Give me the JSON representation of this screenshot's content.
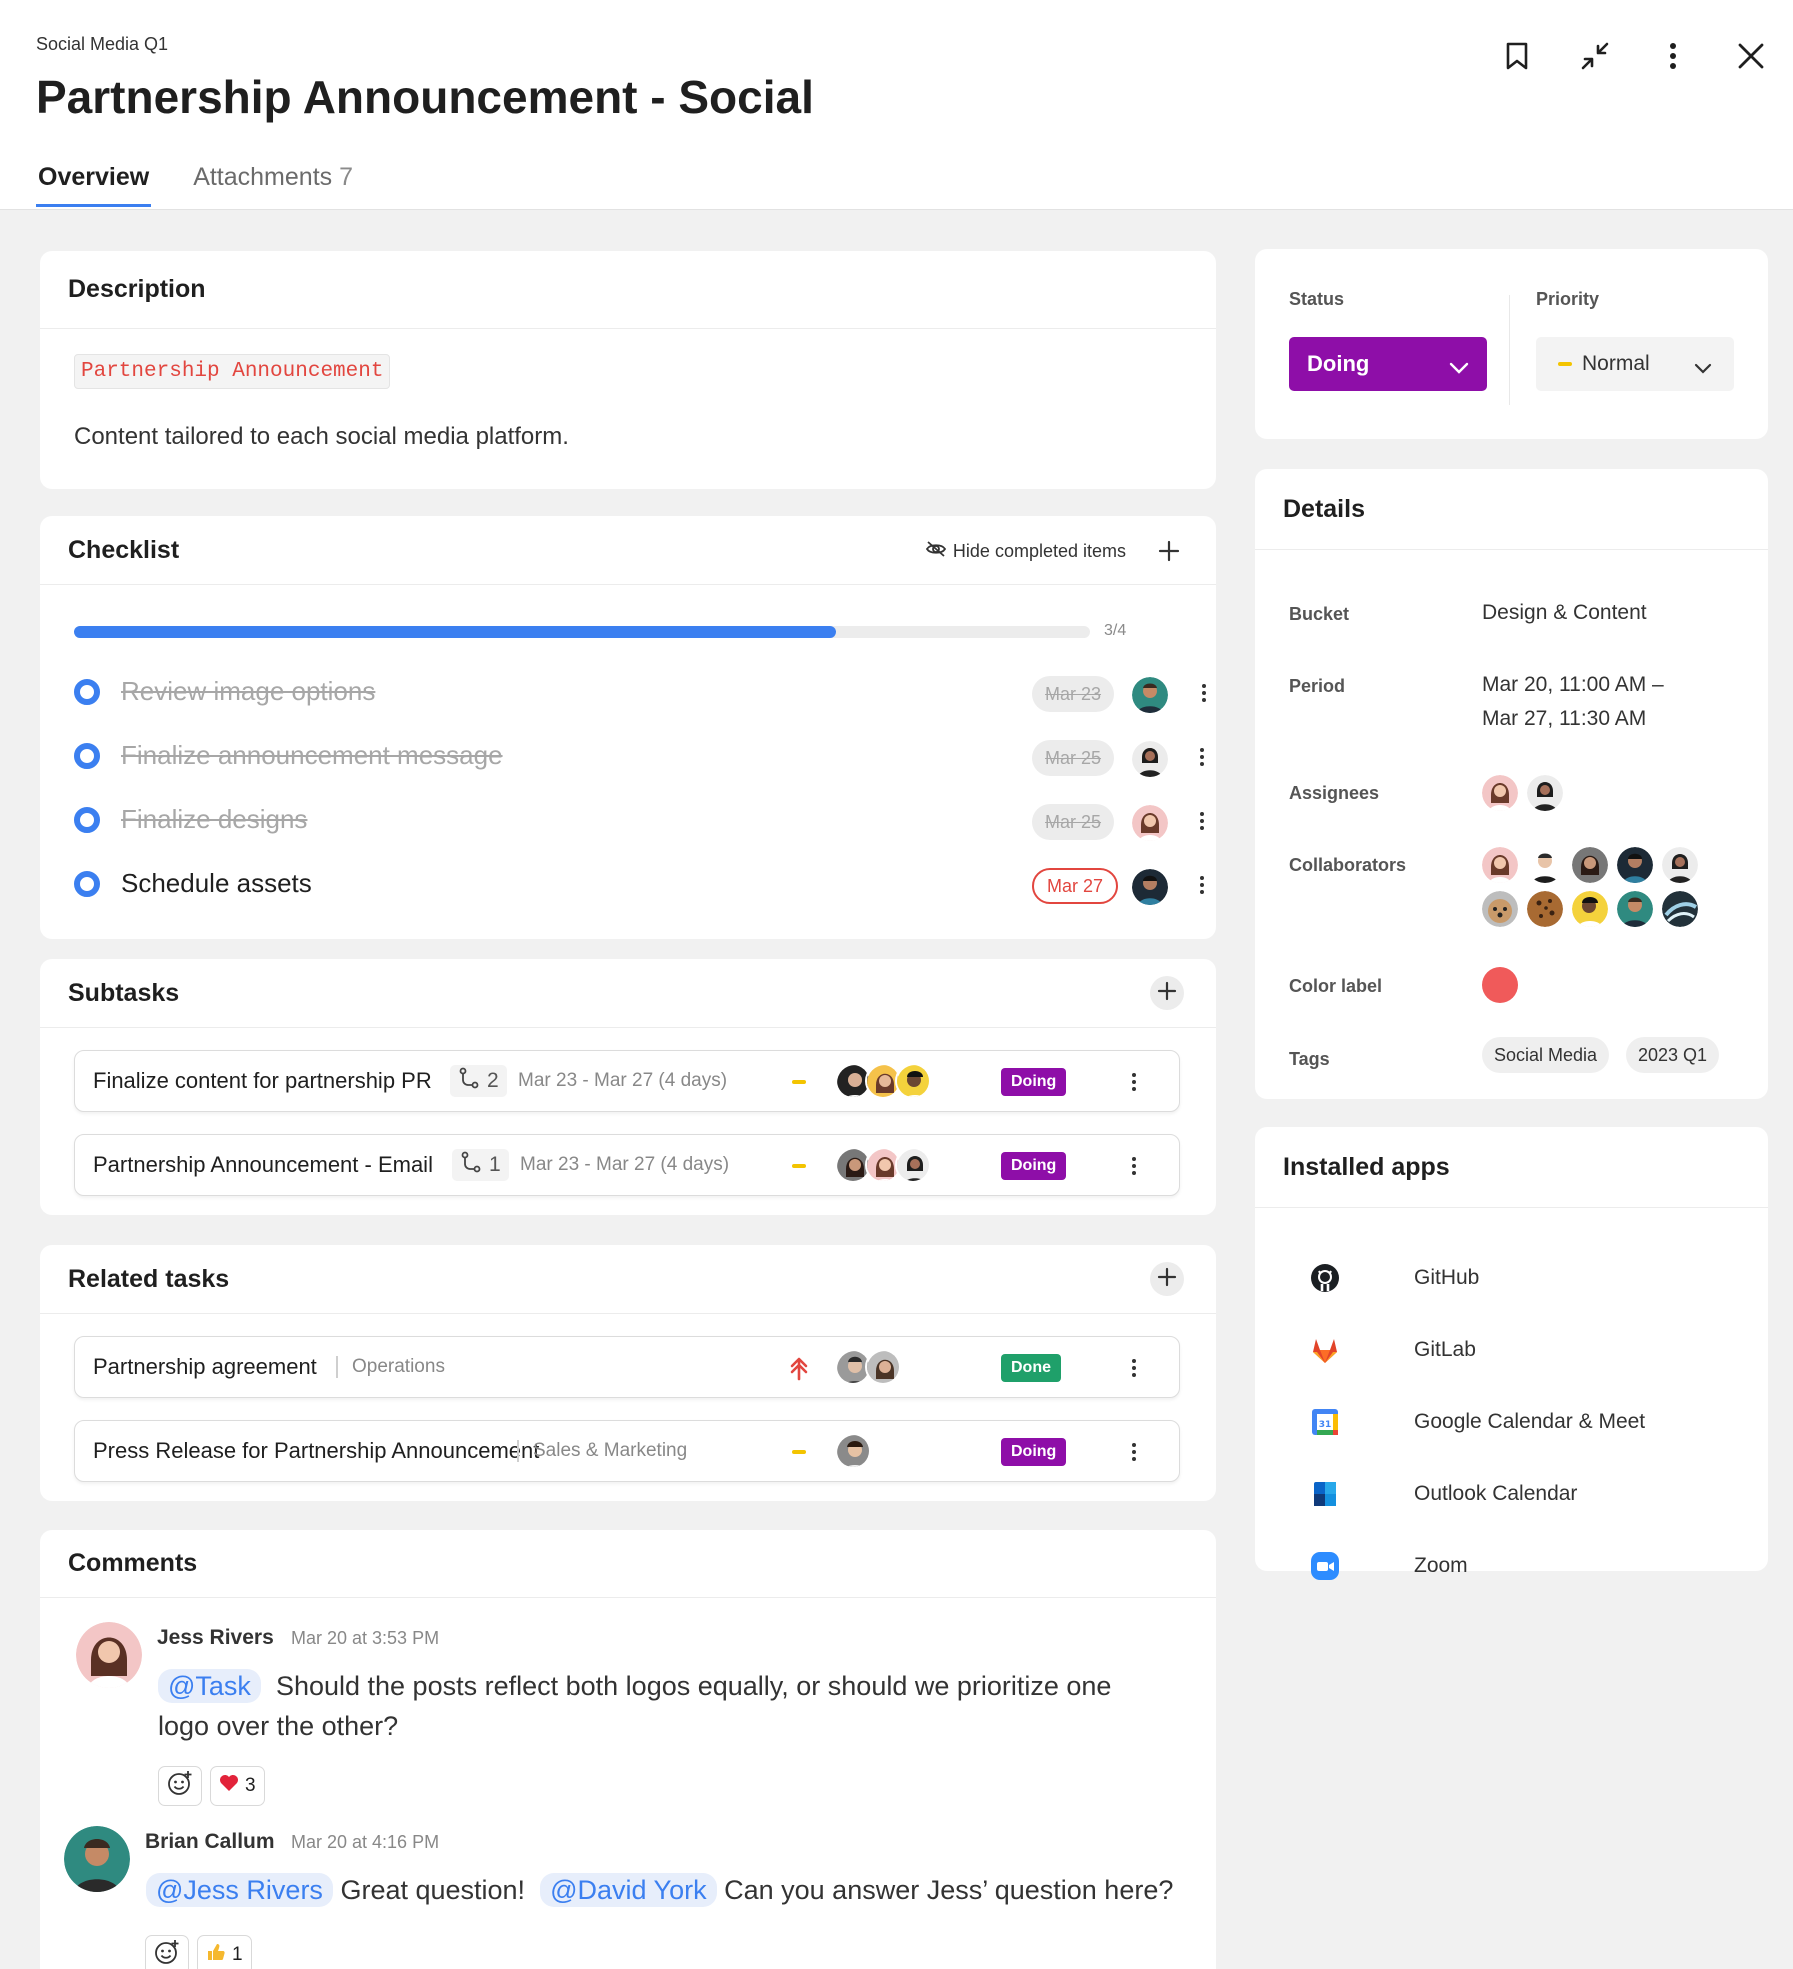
{
  "header": {
    "breadcrumb": "Social Media Q1",
    "title": "Partnership Announcement - Social",
    "tabs": [
      {
        "label": "Overview"
      },
      {
        "label": "Attachments",
        "count": "7"
      }
    ]
  },
  "description": {
    "heading": "Description",
    "code_tag": "Partnership Announcement",
    "text": "Content tailored to each social media platform."
  },
  "checklist": {
    "heading": "Checklist",
    "hide_label": "Hide completed items",
    "progress_label": "3/4",
    "progress_fraction": 0.75,
    "items": [
      {
        "label": "Review image options",
        "date": "Mar 23",
        "done": true
      },
      {
        "label": "Finalize announcement message",
        "date": "Mar 25",
        "done": true
      },
      {
        "label": "Finalize designs",
        "date": "Mar 25",
        "done": true
      },
      {
        "label": "Schedule assets",
        "date": "Mar 27",
        "done": false
      }
    ]
  },
  "subtasks": {
    "heading": "Subtasks",
    "items": [
      {
        "title": "Finalize content for partnership PR",
        "count": "2",
        "dates": "Mar 23 - Mar 27 (4 days)",
        "status": "Doing"
      },
      {
        "title": "Partnership Announcement - Email",
        "count": "1",
        "dates": "Mar 23 - Mar 27 (4 days)",
        "status": "Doing"
      }
    ]
  },
  "related": {
    "heading": "Related tasks",
    "items": [
      {
        "title": "Partnership agreement",
        "project": "Operations",
        "status": "Done"
      },
      {
        "title": "Press Release for Partnership Announcement",
        "project": "Sales & Marketing",
        "status": "Doing"
      }
    ]
  },
  "comments": {
    "heading": "Comments",
    "items": [
      {
        "author": "Jess Rivers",
        "time": "Mar 20 at 3:53 PM",
        "mention": "@Task",
        "text_1": "Should the posts reflect both logos equally, or should we prioritize one",
        "text_2": "logo over the other?",
        "reaction_count": "3"
      },
      {
        "author": "Brian Callum",
        "time": "Mar 20 at 4:16 PM",
        "mention_1": "@Jess Rivers",
        "text_1": "Great question!",
        "mention_2": "@David York",
        "text_2": "Can you answer Jess’ question here?",
        "reaction_count": "1"
      }
    ]
  },
  "status_panel": {
    "status_label": "Status",
    "status_value": "Doing",
    "priority_label": "Priority",
    "priority_value": "Normal"
  },
  "details": {
    "heading": "Details",
    "bucket_label": "Bucket",
    "bucket_value": "Design & Content",
    "period_label": "Period",
    "period_line1": "Mar 20, 11:00 AM –",
    "period_line2": "Mar 27, 11:30 AM",
    "assignees_label": "Assignees",
    "collaborators_label": "Collaborators",
    "color_label": "Color label",
    "color_value": "#f05a5a",
    "tags_label": "Tags",
    "tags": [
      "Social Media",
      "2023 Q1"
    ]
  },
  "apps": {
    "heading": "Installed apps",
    "items": [
      {
        "name": "GitHub",
        "icon": "github-icon"
      },
      {
        "name": "GitLab",
        "icon": "gitlab-icon"
      },
      {
        "name": "Google Calendar & Meet",
        "icon": "google-calendar-icon"
      },
      {
        "name": "Outlook Calendar",
        "icon": "outlook-icon"
      },
      {
        "name": "Zoom",
        "icon": "zoom-icon"
      }
    ]
  },
  "colors": {
    "accent": "#3b7ff0",
    "doing": "#8e0ea8",
    "done": "#1fa06a",
    "danger": "#e2463f",
    "priority_normal": "#f3c400"
  }
}
